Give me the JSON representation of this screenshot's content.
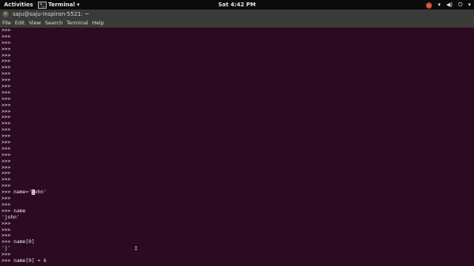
{
  "topbar": {
    "activities": "Activities",
    "app_menu": "Terminal ▾",
    "app_icon_text": ">_",
    "clock": "Sat   4:42 PM",
    "tray": {
      "wifi": "▾",
      "volume": "◀)",
      "power": "⏻",
      "menu": "▾"
    }
  },
  "window": {
    "title": "saju@saju-Inspiron-5521: ~",
    "close_glyph": "×"
  },
  "menubar": {
    "items": [
      "File",
      "Edit",
      "View",
      "Search",
      "Terminal",
      "Help"
    ]
  },
  "terminal": {
    "prompt": ">>>",
    "lines": [
      ">>>",
      ">>>",
      ">>>",
      ">>>",
      ">>>",
      ">>>",
      ">>>",
      ">>>",
      ">>>",
      ">>>",
      ">>>",
      ">>>",
      ">>>",
      ">>>",
      ">>>",
      ">>>",
      ">>>",
      ">>>",
      ">>>",
      ">>>",
      ">>>",
      ">>>",
      ">>>",
      ">>>",
      ">>>",
      ">>>"
    ],
    "assign_prefix": ">>> name='",
    "assign_cursor": "j",
    "assign_suffix": "ohn'",
    "tail_lines": [
      ">>>",
      ">>>",
      ">>> name",
      "'john'",
      ">>>",
      ">>>",
      ">>>",
      ">>> name[0]",
      "'j'",
      ">>>",
      ">>> name[0] = k"
    ]
  }
}
